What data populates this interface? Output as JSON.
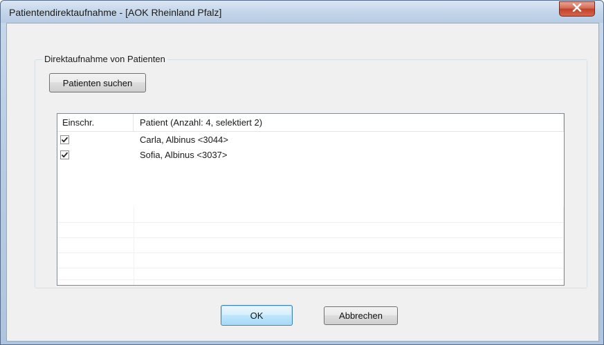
{
  "window": {
    "title": "Patientendirektaufnahme - [AOK Rheinland Pfalz]",
    "close_icon": "close-icon"
  },
  "group": {
    "label": "Direktaufnahme von Patienten",
    "search_button": "Patienten suchen"
  },
  "list": {
    "columns": [
      "Einschr.",
      "Patient (Anzahl: 4, selektiert 2)"
    ],
    "rows": [
      {
        "checked": true,
        "patient": "Carla, Albinus <3044>"
      },
      {
        "checked": true,
        "patient": "Sofia, Albinus <3037>"
      }
    ]
  },
  "footer": {
    "ok_label": "OK",
    "cancel_label": "Abbrechen"
  },
  "colors": {
    "close_button": "#c2412a",
    "dialog_background": "#f0f0f0",
    "ok_border": "#3c7fb1"
  }
}
